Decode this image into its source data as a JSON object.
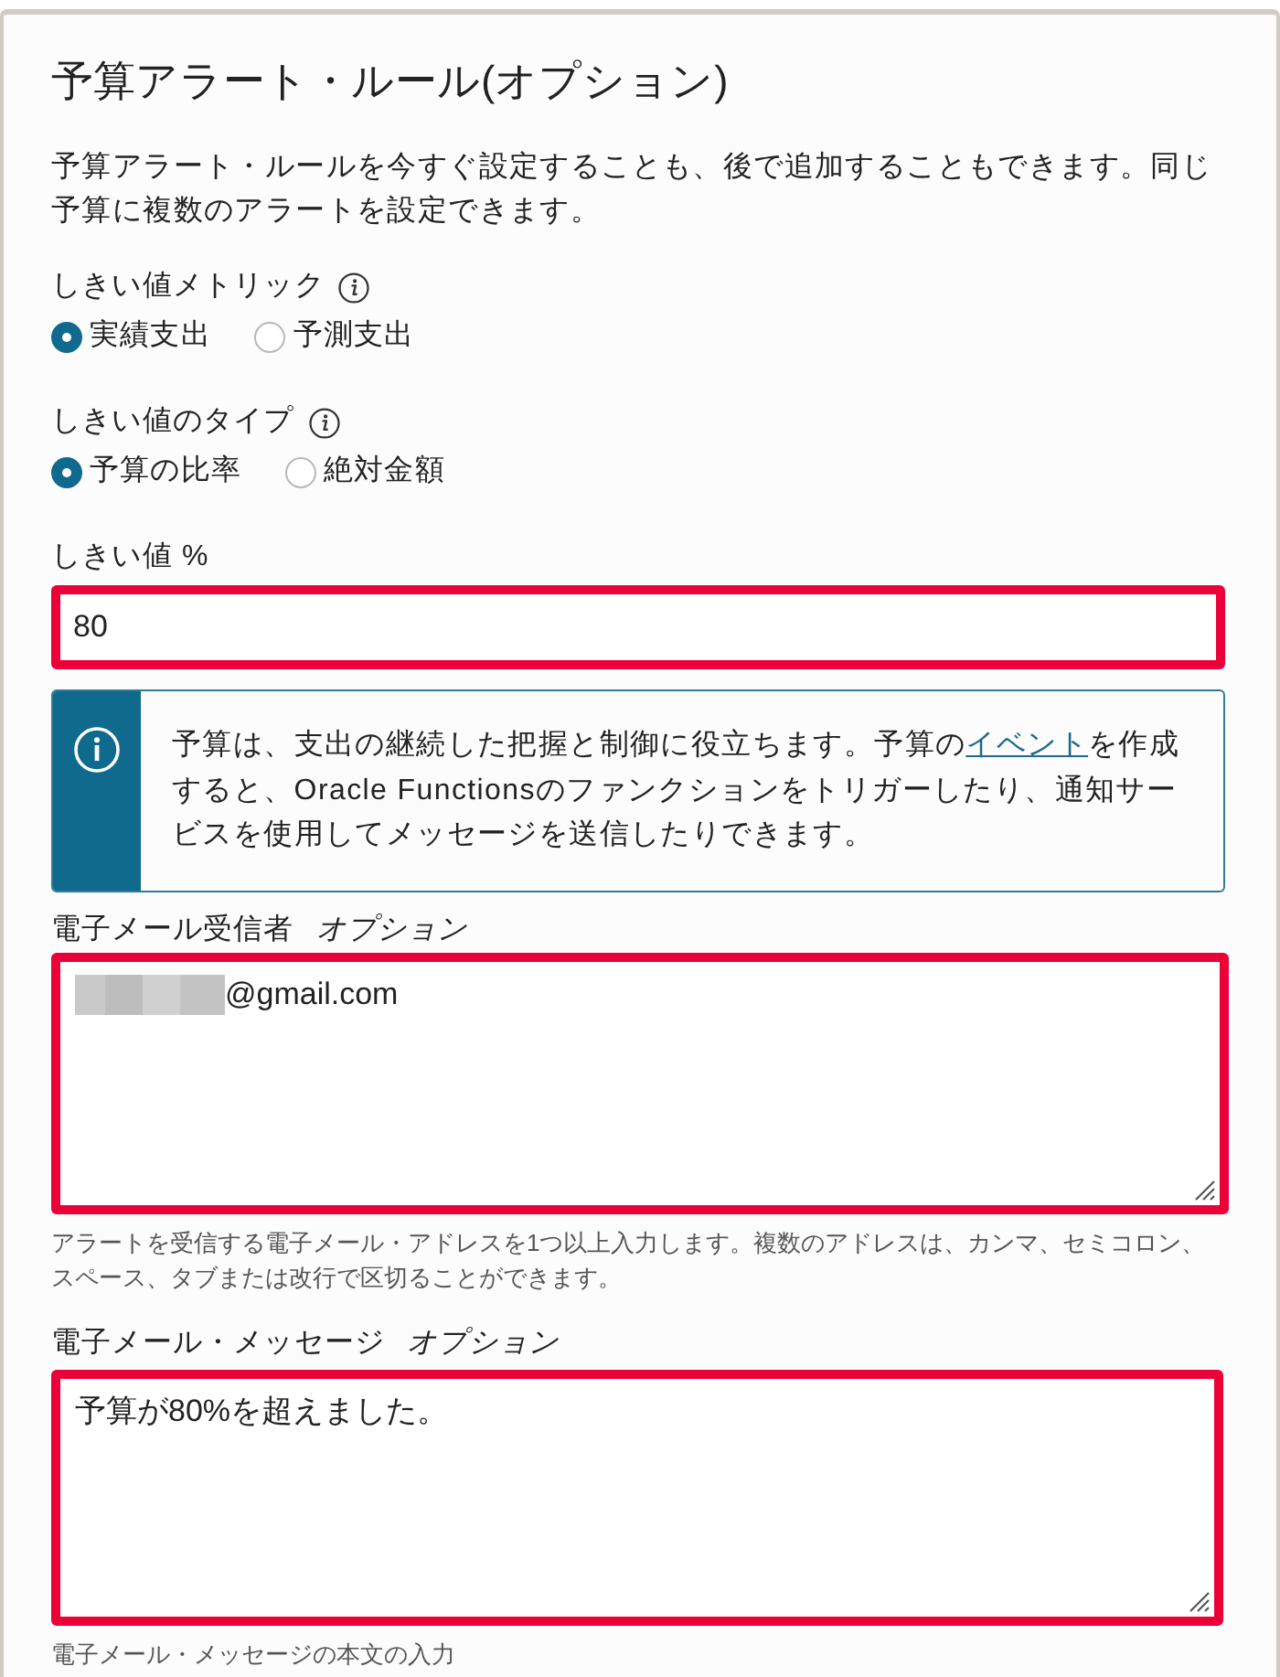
{
  "title": "予算アラート・ルール(オプション)",
  "intro": "予算アラート・ルールを今すぐ設定することも、後で追加することもできます。同じ予算に複数のアラートを設定できます。",
  "fields": [
    {
      "kind": "radio",
      "label": "しきい値メトリック",
      "info_icon": true,
      "options": [
        {
          "label": "実績支出",
          "selected": true
        },
        {
          "label": "予測支出",
          "selected": false
        }
      ]
    },
    {
      "kind": "radio",
      "label": "しきい値のタイプ",
      "info_icon": true,
      "options": [
        {
          "label": "予算の比率",
          "selected": true
        },
        {
          "label": "絶対金額",
          "selected": false
        }
      ]
    },
    {
      "kind": "input",
      "label": "しきい値 %",
      "value": "80",
      "highlighted": true
    },
    {
      "kind": "notice",
      "text_before": "予算は、支出の継続した把握と制御に役立ちます。予算の",
      "link": "イベント",
      "text_after": "を作成すると、Oracle Functionsのファンクションをトリガーしたり、通知サービスを使用してメッセージを送信したりできます。"
    },
    {
      "kind": "textarea",
      "label": "電子メール受信者",
      "optional": "オプション",
      "redacted": true,
      "value": "@gmail.com",
      "highlighted": true,
      "help": "アラートを受信する電子メール・アドレスを1つ以上入力します。複数のアドレスは、カンマ、セミコロン、スペース、タブまたは改行で区切ることができます。"
    },
    {
      "kind": "textarea",
      "label": "電子メール・メッセージ",
      "optional": "オプション",
      "value": "予算が80%を超えました。",
      "highlighted": true,
      "help": "電子メール・メッセージの本文の入力"
    }
  ]
}
